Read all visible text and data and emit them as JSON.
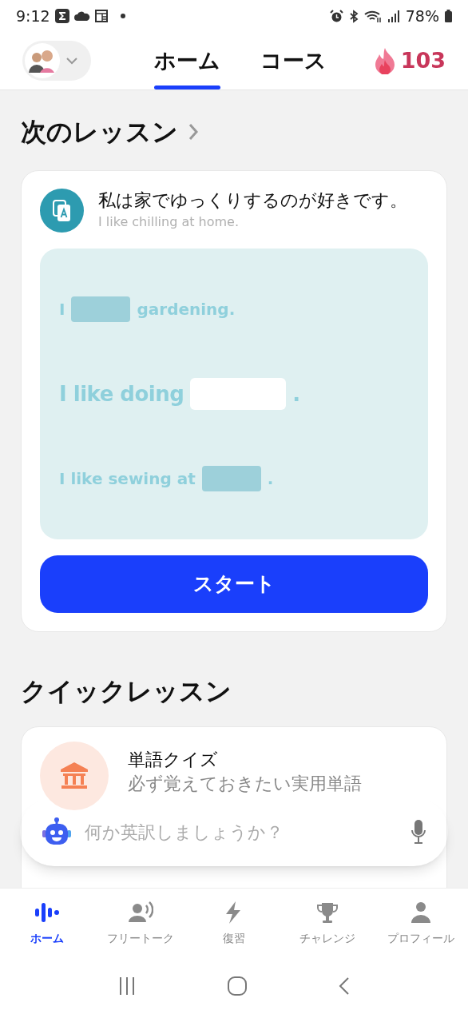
{
  "status_bar": {
    "time": "9:12",
    "battery": "78%"
  },
  "header": {
    "tabs": [
      {
        "label": "ホーム",
        "selected": true
      },
      {
        "label": "コース",
        "selected": false
      }
    ],
    "streak": "103"
  },
  "next_lesson": {
    "title": "次のレッスン",
    "sentence": "私は家でゆっくりするのが好きです。",
    "translation": "I like chilling at home.",
    "exercises": [
      {
        "current": false,
        "parts": [
          {
            "kind": "text",
            "text": "I"
          },
          {
            "kind": "blank"
          },
          {
            "kind": "text",
            "text": "gardening."
          }
        ]
      },
      {
        "current": true,
        "parts": [
          {
            "kind": "text",
            "text": "I like doing"
          },
          {
            "kind": "answer"
          },
          {
            "kind": "text",
            "text": "."
          }
        ]
      },
      {
        "current": false,
        "parts": [
          {
            "kind": "text",
            "text": "I like sewing at"
          },
          {
            "kind": "blank"
          },
          {
            "kind": "text",
            "text": "."
          }
        ]
      }
    ],
    "start": "スタート"
  },
  "quick_lessons": {
    "title": "クイックレッスン",
    "items": [
      {
        "title": "単語クイズ",
        "subtitle": "必ず覚えておきたい実用単語",
        "kind": "bank"
      }
    ]
  },
  "assistant": {
    "placeholder": "何か英訳しましょうか？"
  },
  "bottom_nav": [
    {
      "label": "ホーム",
      "kind": "home",
      "selected": true
    },
    {
      "label": "フリートーク",
      "kind": "talk",
      "selected": false
    },
    {
      "label": "復習",
      "kind": "review",
      "selected": false
    },
    {
      "label": "チャレンジ",
      "kind": "challenge",
      "selected": false
    },
    {
      "label": "プロフィール",
      "kind": "profile",
      "selected": false
    }
  ]
}
